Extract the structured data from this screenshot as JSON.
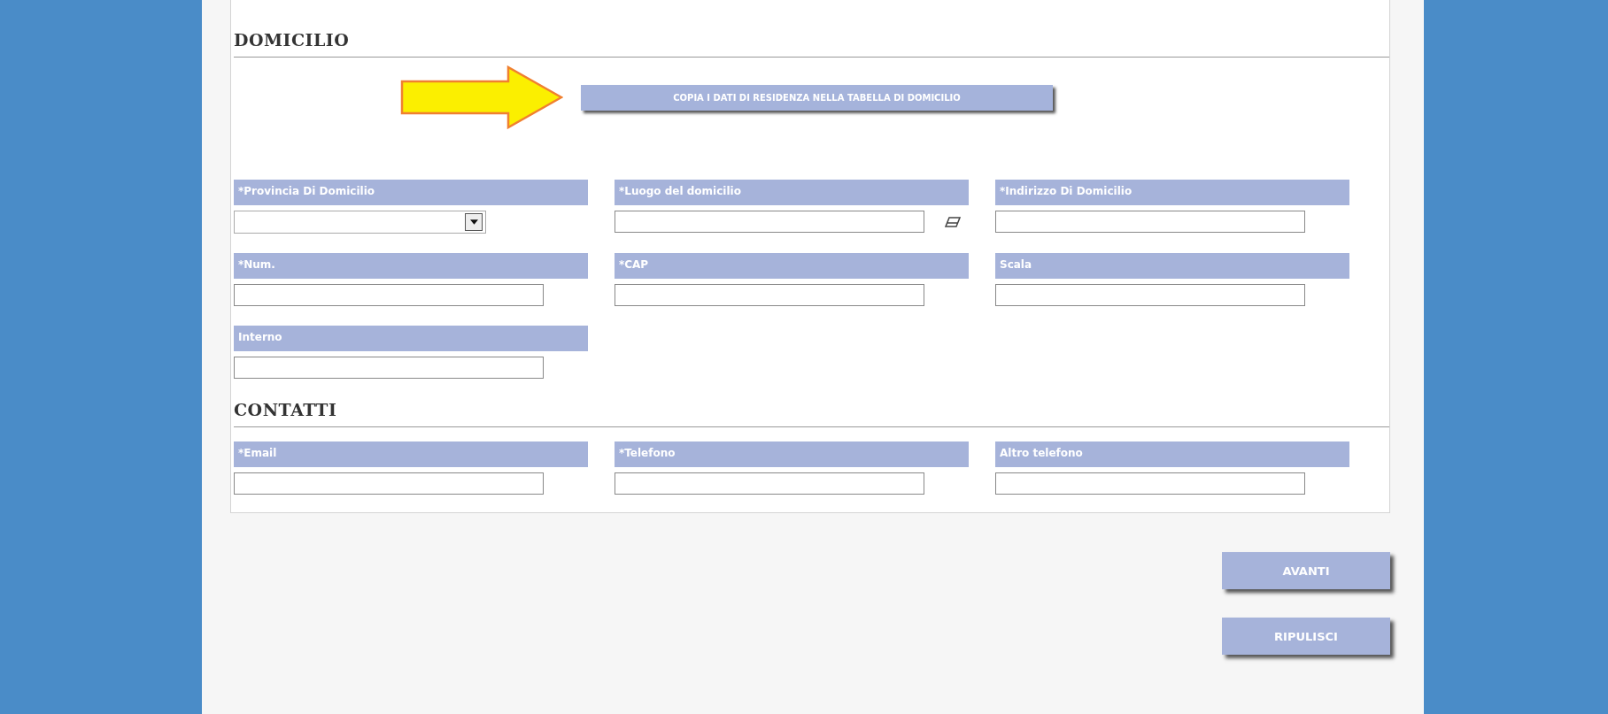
{
  "sections": [
    {
      "title": "DOMICILIO",
      "copy_button": "COPIA I DATI DI RESIDENZA NELLA TABELLA DI DOMICILIO",
      "fields": [
        {
          "label": "*Provincia Di Domicilio",
          "kind": "select"
        },
        {
          "label": "*Luogo del domicilio",
          "kind": "lookup"
        },
        {
          "label": "*Indirizzo Di Domicilio",
          "kind": "text"
        },
        {
          "label": "*Num.",
          "kind": "text"
        },
        {
          "label": "*CAP",
          "kind": "text"
        },
        {
          "label": "Scala",
          "kind": "text"
        },
        {
          "label": "Interno",
          "kind": "text"
        }
      ]
    },
    {
      "title": "CONTATTI",
      "fields": [
        {
          "label": "*Email",
          "kind": "text"
        },
        {
          "label": "*Telefono",
          "kind": "text"
        },
        {
          "label": "Altro telefono",
          "kind": "text"
        }
      ]
    }
  ],
  "buttons": [
    "AVANTI",
    "RIPULISCI"
  ]
}
